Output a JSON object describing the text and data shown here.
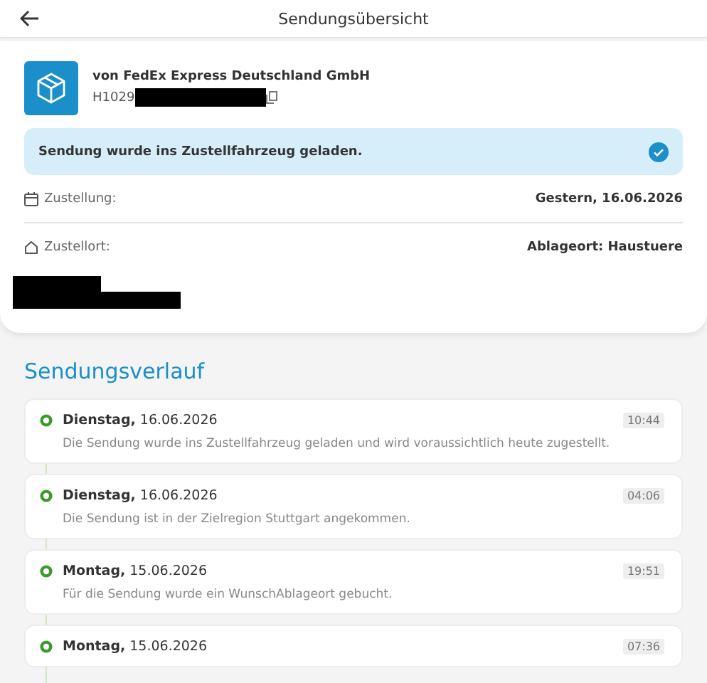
{
  "header": {
    "title": "Sendungsübersicht"
  },
  "shipment": {
    "sender": "von FedEx Express Deutschland GmbH",
    "tracking_number": "H1029",
    "status": "Sendung wurde ins Zustellfahrzeug geladen.",
    "status_done": true,
    "details": [
      {
        "kind": "date",
        "label": "Zustellung:",
        "value": "Gestern, 16.06.2026"
      },
      {
        "kind": "place",
        "label": "Zustellort:",
        "value": "Ablageort: Haustuere"
      }
    ]
  },
  "history": {
    "title": "Sendungsverlauf",
    "events": [
      {
        "date": "**Dienstag,** 16.06.2026",
        "time": "10:44",
        "text": "Die Sendung wurde ins Zustellfahrzeug geladen und wird voraussichtlich heute zugestellt."
      },
      {
        "date": "**Dienstag,** 16.06.2026",
        "time": "04:06",
        "text": "Die Sendung ist in der Zielregion Stuttgart angekommen."
      },
      {
        "date": "**Montag,** 15.06.2026",
        "time": "19:51",
        "text": "Für die Sendung wurde ein WunschAblageort gebucht."
      },
      {
        "date": "**Montag,** 15.06.2026",
        "time": "07:36"
      }
    ]
  }
}
